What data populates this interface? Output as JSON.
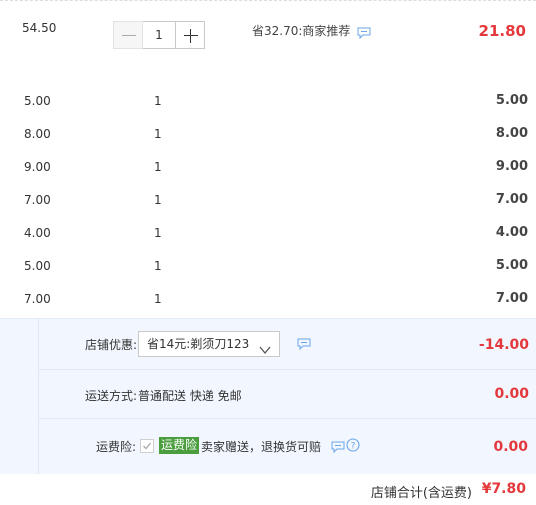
{
  "order_item": {
    "unit_price": "54.50",
    "quantity": "1",
    "promo_text": "省32.70:商家推荐",
    "subtotal": "21.80"
  },
  "sub_items": [
    {
      "price": "5.00",
      "qty": "1",
      "total": "5.00"
    },
    {
      "price": "8.00",
      "qty": "1",
      "total": "8.00"
    },
    {
      "price": "9.00",
      "qty": "1",
      "total": "9.00"
    },
    {
      "price": "7.00",
      "qty": "1",
      "total": "7.00"
    },
    {
      "price": "4.00",
      "qty": "1",
      "total": "4.00"
    },
    {
      "price": "5.00",
      "qty": "1",
      "total": "5.00"
    },
    {
      "price": "7.00",
      "qty": "1",
      "total": "7.00"
    }
  ],
  "shop_discount": {
    "label": "店铺优惠:",
    "selected": "省14元:剃须刀123",
    "amount": "-14.00"
  },
  "shipping": {
    "label": "运送方式:",
    "method": "普通配送 快递 免邮",
    "amount": "0.00"
  },
  "insurance": {
    "label": "运费险:",
    "badge": "运费险",
    "text": "卖家赠送，退换货可赔",
    "amount": "0.00"
  },
  "footer": {
    "label": "店铺合计(含运费)",
    "total": "¥7.80"
  },
  "colors": {
    "price_red": "#e4393c",
    "shop_bg": "#f2f7ff",
    "badge_green": "#4a9e3d",
    "icon_blue": "#6aa5e8"
  },
  "icons": {
    "chat": "chat-bubble-icon",
    "help": "question-circle-icon",
    "chevron": "chevron-down-icon",
    "check": "checkmark-icon"
  }
}
